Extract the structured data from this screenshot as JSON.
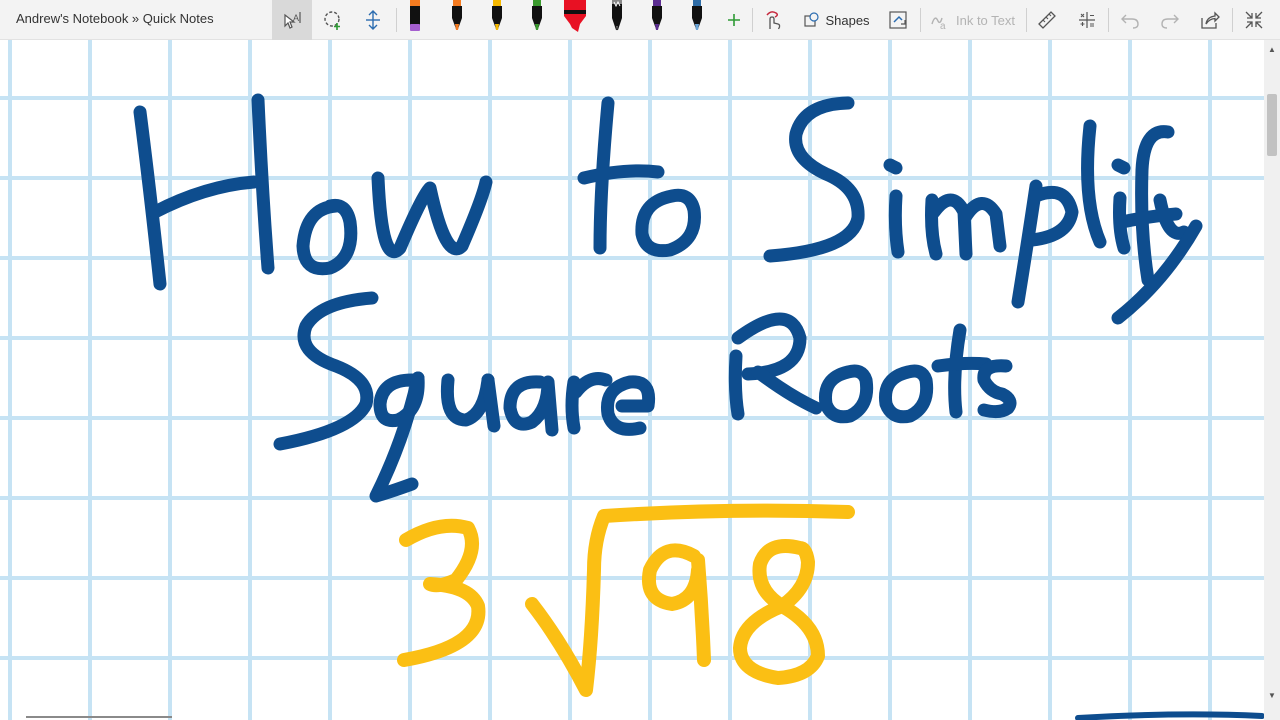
{
  "breadcrumb": "Andrew's Notebook » Quick Notes",
  "toolbar": {
    "shapes_label": "Shapes",
    "ink_to_text_label": "Ink to Text",
    "pens": [
      {
        "name": "purple-highlighter",
        "color": "#a55fcf"
      },
      {
        "name": "orange-pen",
        "color": "#f47b20"
      },
      {
        "name": "yellow-pen",
        "color": "#f5b800"
      },
      {
        "name": "green-pen",
        "color": "#3a9a2e"
      },
      {
        "name": "red-highlighter",
        "color": "#e81123"
      },
      {
        "name": "pencil",
        "color": "#444444"
      },
      {
        "name": "purple-pen",
        "color": "#5c2d91"
      },
      {
        "name": "galaxy-pen",
        "color": "#2e6ca6"
      }
    ]
  },
  "ink": {
    "title_color": "#0e4d8e",
    "math_color": "#fbbf14"
  },
  "canvas": {
    "grid_line_color": "#c6e3f4",
    "background": "#ffffff"
  }
}
